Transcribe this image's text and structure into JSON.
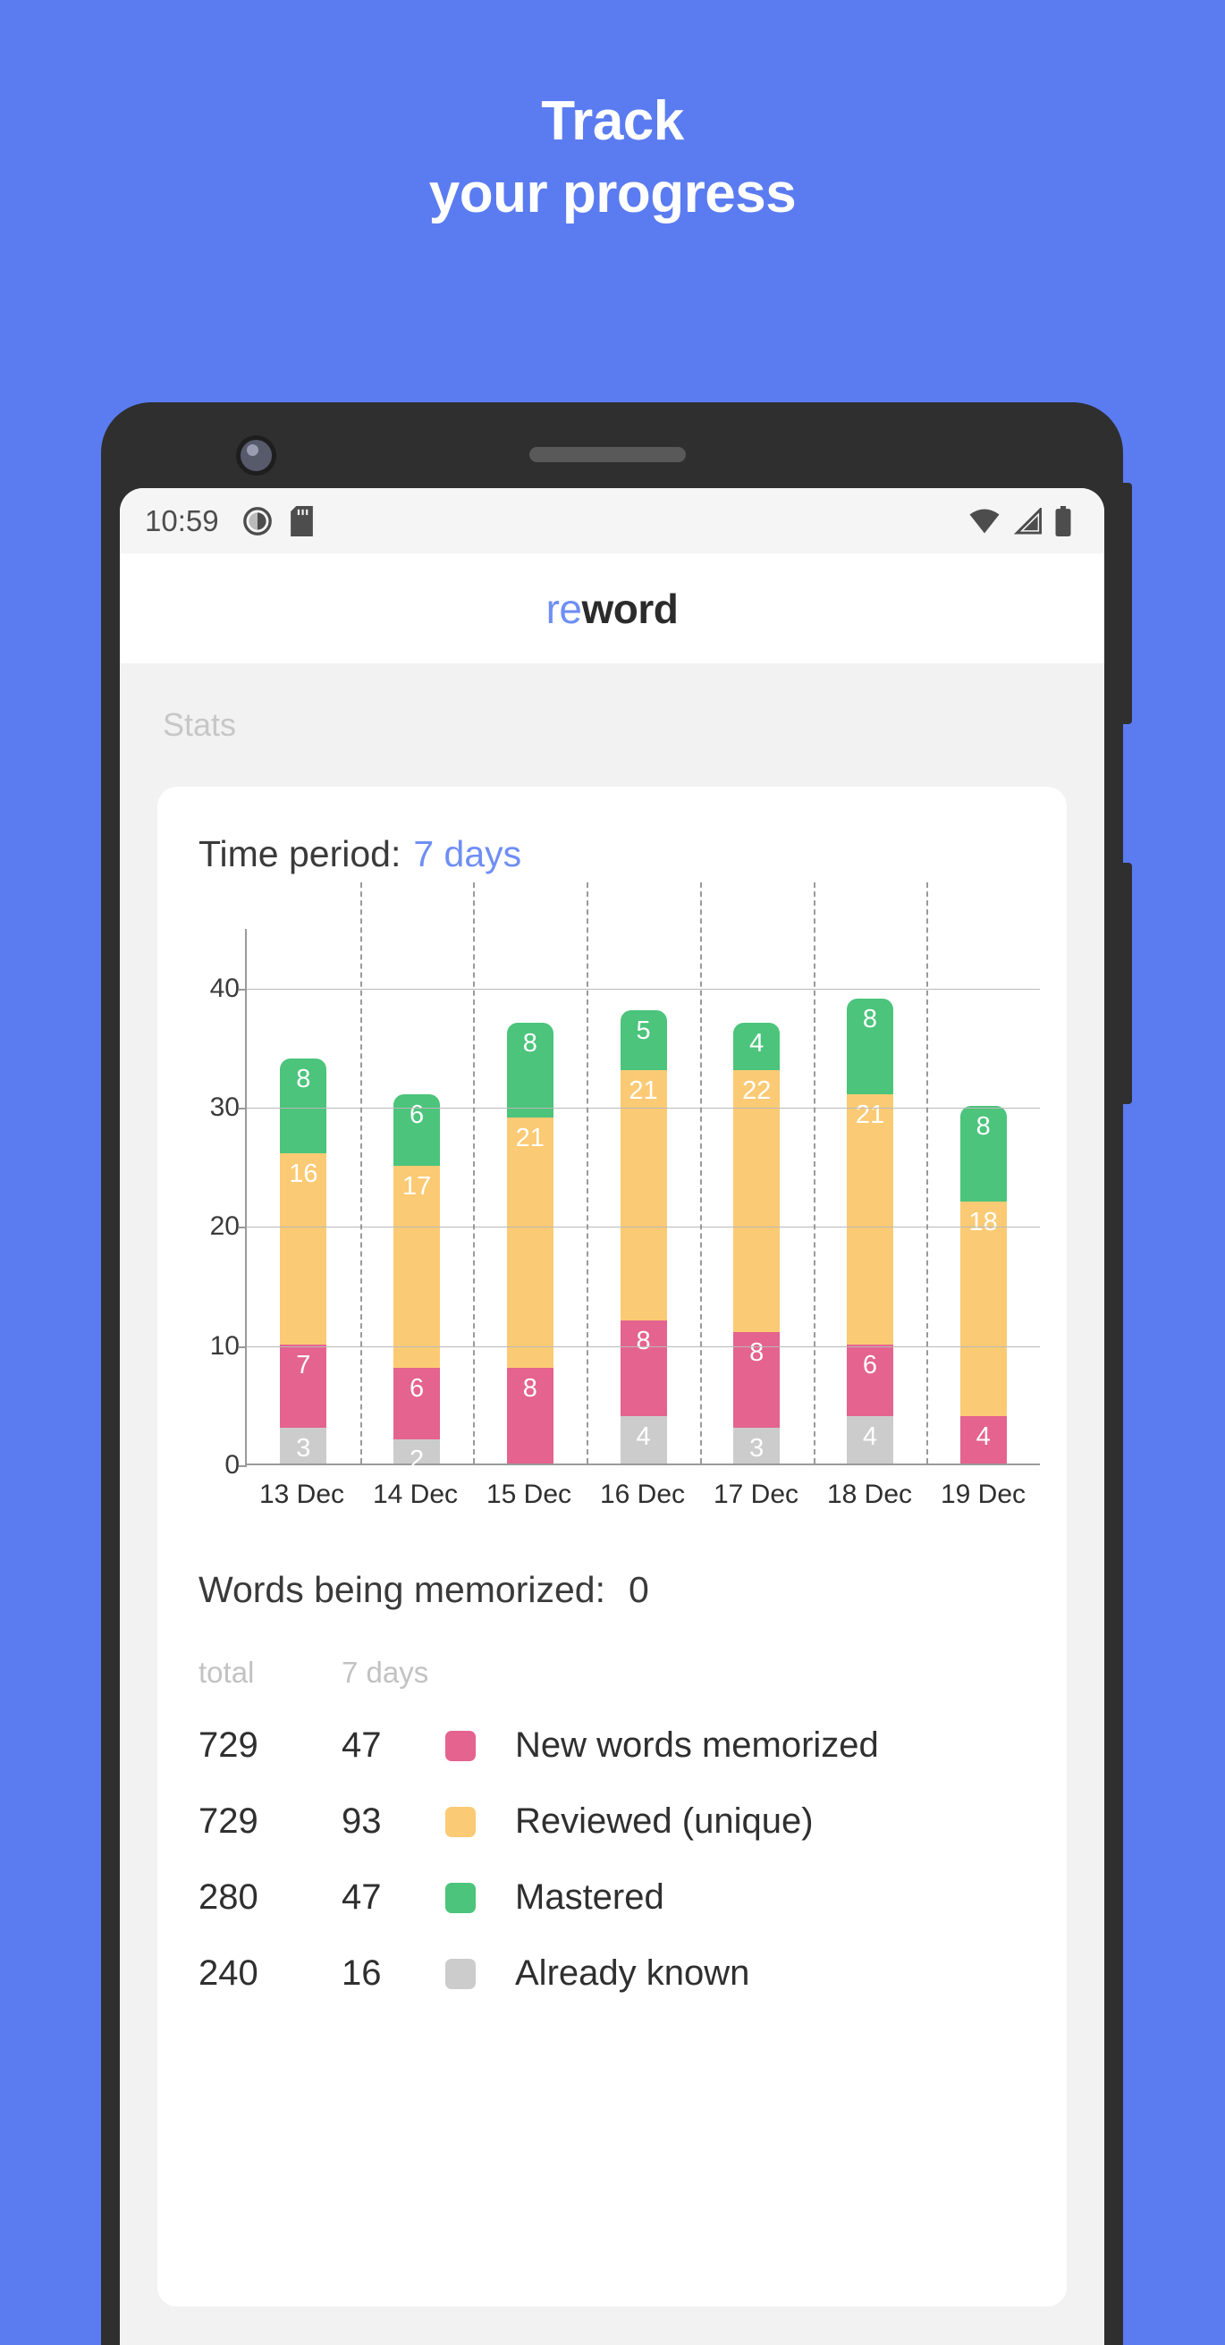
{
  "promo": {
    "line1": "Track",
    "line2": "your progress",
    "background_color": "#5b7cf0",
    "text_color": "#ffffff"
  },
  "phone": {
    "statusbar": {
      "time": "10:59",
      "left_icons": [
        "do-not-disturb-icon",
        "sd-card-icon"
      ],
      "right_icons": [
        "wifi-icon",
        "cell-signal-icon",
        "battery-icon"
      ]
    },
    "appbar": {
      "logo_prefix": "re",
      "logo_suffix": "word",
      "accent": "#6f8ef5"
    }
  },
  "screen": {
    "section_label": "Stats",
    "time_period": {
      "label": "Time period:",
      "value": "7 days"
    },
    "memorized": {
      "label": "Words being memorized:",
      "value": "0"
    }
  },
  "chart_data": {
    "type": "bar",
    "stacked": true,
    "title": "",
    "xlabel": "",
    "ylabel": "",
    "ylim": [
      0,
      45
    ],
    "yticks": [
      0,
      10,
      20,
      30,
      40
    ],
    "grid": true,
    "legend_position": "below",
    "categories": [
      "13 Dec",
      "14 Dec",
      "15 Dec",
      "16 Dec",
      "17 Dec",
      "18 Dec",
      "19 Dec"
    ],
    "series": [
      {
        "name": "Already known",
        "color": "#cccccc",
        "values": [
          3,
          2,
          0,
          4,
          3,
          4,
          0
        ]
      },
      {
        "name": "New words memorized",
        "color": "#e4638f",
        "values": [
          7,
          6,
          8,
          8,
          8,
          6,
          4
        ]
      },
      {
        "name": "Reviewed (unique)",
        "color": "#fbca74",
        "values": [
          16,
          17,
          21,
          21,
          22,
          21,
          18
        ]
      },
      {
        "name": "Mastered",
        "color": "#4cc47c",
        "values": [
          8,
          6,
          8,
          5,
          4,
          8,
          8
        ]
      }
    ],
    "totals": [
      34,
      31,
      37,
      38,
      37,
      39,
      30
    ]
  },
  "legend": {
    "headers": {
      "total": "total",
      "period": "7 days"
    },
    "rows": [
      {
        "total": "729",
        "period": "47",
        "color": "#e4638f",
        "name": "New words memorized"
      },
      {
        "total": "729",
        "period": "93",
        "color": "#fbca74",
        "name": "Reviewed (unique)"
      },
      {
        "total": "280",
        "period": "47",
        "color": "#4cc47c",
        "name": "Mastered"
      },
      {
        "total": "240",
        "period": "16",
        "color": "#cccccc",
        "name": "Already known"
      }
    ]
  }
}
